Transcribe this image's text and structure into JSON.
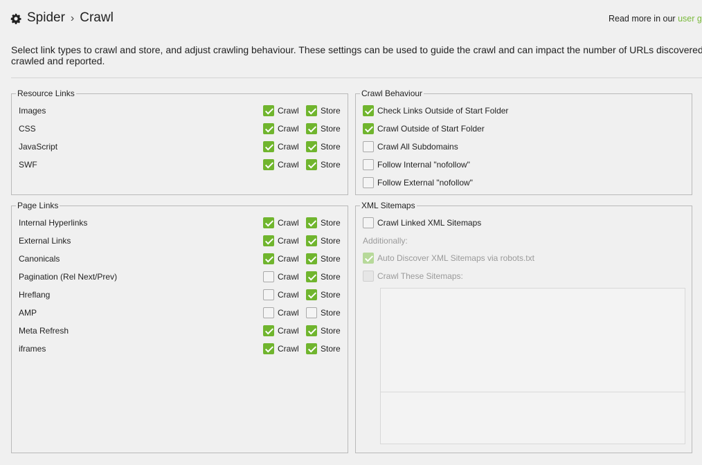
{
  "header": {
    "breadcrumb": [
      "Spider",
      "Crawl"
    ],
    "separator": "›",
    "readmore_prefix": "Read more in our ",
    "readmore_link": "user guide"
  },
  "description_line1": "Select link types to crawl and store, and adjust crawling behaviour. These settings can be used to guide the crawl and can impact the number of URLs discovered,",
  "description_line2": "crawled and reported.",
  "resource_links": {
    "title": "Resource Links",
    "crawl_label": "Crawl",
    "store_label": "Store",
    "items": [
      {
        "label": "Images",
        "crawl": true,
        "store": true
      },
      {
        "label": "CSS",
        "crawl": true,
        "store": true
      },
      {
        "label": "JavaScript",
        "crawl": true,
        "store": true
      },
      {
        "label": "SWF",
        "crawl": true,
        "store": true
      }
    ]
  },
  "page_links": {
    "title": "Page Links",
    "crawl_label": "Crawl",
    "store_label": "Store",
    "items": [
      {
        "label": "Internal Hyperlinks",
        "crawl": true,
        "store": true
      },
      {
        "label": "External Links",
        "crawl": true,
        "store": true
      },
      {
        "label": "Canonicals",
        "crawl": true,
        "store": true
      },
      {
        "label": "Pagination (Rel Next/Prev)",
        "crawl": false,
        "store": true
      },
      {
        "label": "Hreflang",
        "crawl": false,
        "store": true
      },
      {
        "label": "AMP",
        "crawl": false,
        "store": false
      },
      {
        "label": "Meta Refresh",
        "crawl": true,
        "store": true
      },
      {
        "label": "iframes",
        "crawl": true,
        "store": true
      }
    ]
  },
  "crawl_behaviour": {
    "title": "Crawl Behaviour",
    "items": [
      {
        "label": "Check Links Outside of Start Folder",
        "checked": true
      },
      {
        "label": "Crawl Outside of Start Folder",
        "checked": true
      },
      {
        "label": "Crawl All Subdomains",
        "checked": false
      },
      {
        "label": "Follow Internal \"nofollow\"",
        "checked": false
      },
      {
        "label": "Follow External \"nofollow\"",
        "checked": false
      }
    ]
  },
  "xml_sitemaps": {
    "title": "XML Sitemaps",
    "crawl_linked": {
      "label": "Crawl Linked XML Sitemaps",
      "checked": false
    },
    "additionally": "Additionally:",
    "auto_discover": {
      "label": "Auto Discover XML Sitemaps via robots.txt",
      "checked": true,
      "disabled": true
    },
    "crawl_these": {
      "label": "Crawl These Sitemaps:",
      "checked": false,
      "disabled": true
    },
    "sitemaps_text": ""
  },
  "colors": {
    "accent": "#70b52e",
    "link": "#79b93a",
    "background": "#f0f0f0"
  }
}
